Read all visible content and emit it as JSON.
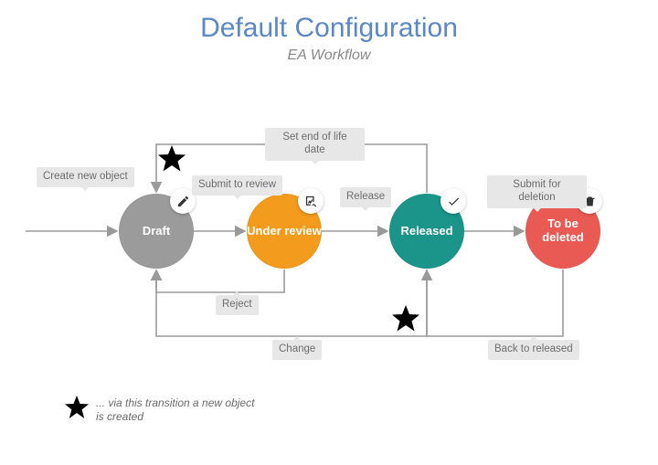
{
  "title": "Default Configuration",
  "subtitle": "EA Workflow",
  "states": {
    "draft": "Draft",
    "review": "Under review",
    "released": "Released",
    "deleted": "To be deleted"
  },
  "transitions": {
    "create": "Create new object",
    "submit_review": "Submit to review",
    "release": "Release",
    "submit_delete": "Submit for deletion",
    "reject": "Reject",
    "change": "Change",
    "back_released": "Back to released",
    "eol": "Set end of life date"
  },
  "legend": "... via this transition a new object is created",
  "colors": {
    "draft": "#9b9b9b",
    "review": "#f29b1d",
    "released": "#1b9489",
    "deleted": "#ea5a55",
    "title": "#5a87c6"
  }
}
